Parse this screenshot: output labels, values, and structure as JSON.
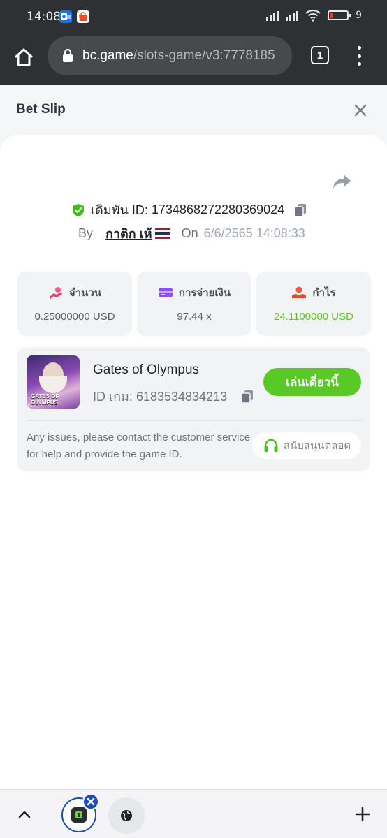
{
  "status_bar": {
    "time": "14:08",
    "battery_text": "9",
    "battery_level_percent": 9,
    "notification_icons": [
      "outlook-icon",
      "shopee-icon"
    ],
    "colors": {
      "battery_low": "#e53935"
    }
  },
  "browser": {
    "url_host": "bc.game",
    "url_path": "/slots-game/v3:7778185",
    "tab_count": "1"
  },
  "header": {
    "title": "Bet Slip"
  },
  "bet": {
    "id_label": "เดิมพัน ID:",
    "id_value": "1734868272280369024",
    "by_label": "By",
    "user": "กาติก เห้",
    "on_label": "On",
    "datetime": "6/6/2565 14:08:33"
  },
  "stats": [
    {
      "label": "จำนวน",
      "value": "0.25000000 USD",
      "icon": "amount-icon"
    },
    {
      "label": "การจ่ายเงิน",
      "value": "97.44 x",
      "icon": "card-icon"
    },
    {
      "label": "กำไร",
      "value": "24.1100000 USD",
      "icon": "profit-icon"
    }
  ],
  "game": {
    "name": "Gates of Olympus",
    "thumb_text": "GATES OF OLYMPUS",
    "id_label": "ID เกม:",
    "id_value": "6183534834213",
    "play_label": "เล่นเดี่ยวนี้",
    "issue_text": "Any issues, please contact the customer service for help and provide the game ID.",
    "support_label": "สนับสนุนตลอด"
  },
  "colors": {
    "accent_green": "#58c925",
    "profit_green": "#5cc51e",
    "tab_blue": "#1e4fb8"
  }
}
